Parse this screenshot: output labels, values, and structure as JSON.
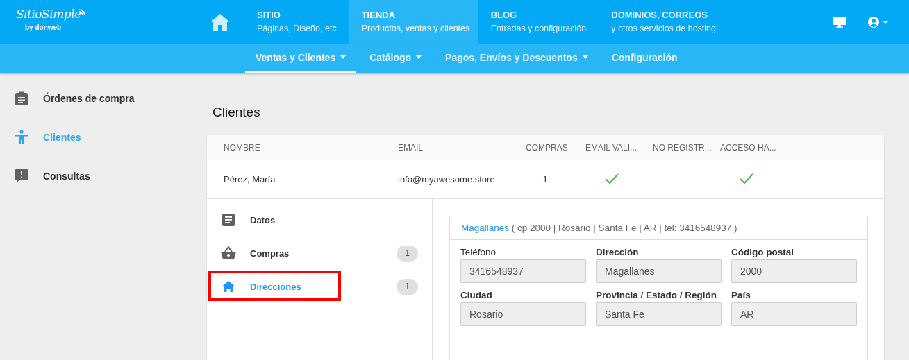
{
  "logo": {
    "name": "SitioSimple",
    "tagline": "by donweb"
  },
  "main_nav": [
    {
      "title": "SITIO",
      "subtitle": "Páginas, Diseño, etc",
      "selected": false
    },
    {
      "title": "TIENDA",
      "subtitle": "Productos, ventas y clientes",
      "selected": true
    },
    {
      "title": "BLOG",
      "subtitle": "Entradas y configuración",
      "selected": false
    },
    {
      "title": "DOMINIOS, CORREOS",
      "subtitle": "y otros servicios de hosting",
      "selected": false
    }
  ],
  "sub_nav": [
    {
      "label": "Ventas y Clientes",
      "dropdown": true,
      "selected": true
    },
    {
      "label": "Catálogo",
      "dropdown": true,
      "selected": false
    },
    {
      "label": "Pagos, Envíos y Descuentos",
      "dropdown": true,
      "selected": false
    },
    {
      "label": "Configuración",
      "dropdown": false,
      "selected": false
    }
  ],
  "sidebar": {
    "items": [
      {
        "label": "Órdenes de compra",
        "kind": "orders",
        "selected": false
      },
      {
        "label": "Clientes",
        "kind": "clients",
        "selected": true
      },
      {
        "label": "Consultas",
        "kind": "queries",
        "selected": false
      }
    ]
  },
  "page_title": "Clientes",
  "table": {
    "columns": [
      "NOMBRE",
      "EMAIL",
      "COMPRAS",
      "EMAIL VALI...",
      "NO REGISTR...",
      "ACCESO HA..."
    ],
    "rows": [
      {
        "nombre": "Pérez, María",
        "email": "info@myawesome.store",
        "compras": "1",
        "checks": [
          {
            "checked": true
          },
          {
            "checked": false
          },
          {
            "checked": true
          }
        ]
      }
    ]
  },
  "detail_menu": [
    {
      "label": "Datos",
      "kind": "data",
      "selected": false,
      "highlighted": false
    },
    {
      "label": "Compras",
      "kind": "purchases",
      "count": "1",
      "selected": false,
      "highlighted": false
    },
    {
      "label": "Direcciones",
      "kind": "addresses",
      "count": "1",
      "selected": true,
      "highlighted": true
    }
  ],
  "address": {
    "street": "Magallanes",
    "summary": "( cp 2000 | Rosario | Santa Fe | AR | tel: 3416548937 )",
    "fields": [
      {
        "label": "Teléfono",
        "value": "3416548937"
      },
      {
        "label": "Dirección",
        "value": "Magallanes"
      },
      {
        "label": "Código postal",
        "value": "2000"
      },
      {
        "label": "Ciudad",
        "value": "Rosario"
      },
      {
        "label": "Provincia / Estado / Región",
        "value": "Santa Fe"
      },
      {
        "label": "País",
        "value": "AR"
      }
    ]
  }
}
